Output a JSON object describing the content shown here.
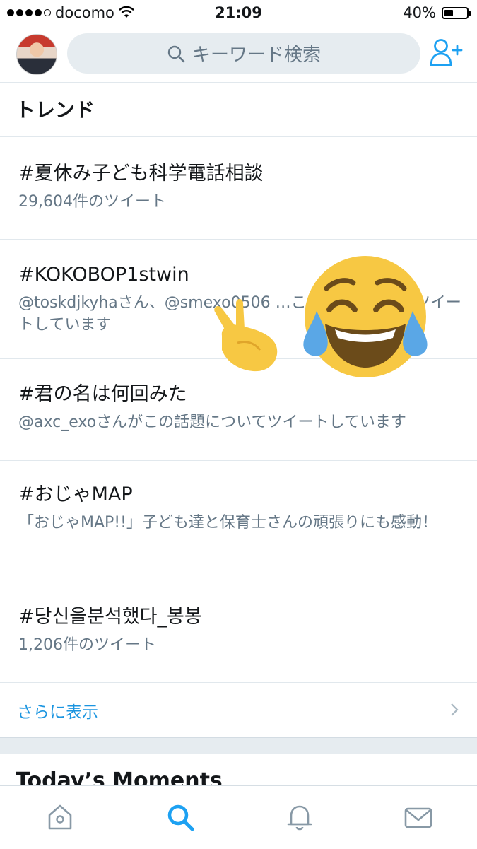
{
  "status_bar": {
    "carrier": "docomo",
    "time": "21:09",
    "battery": "40%",
    "battery_level": 0.4
  },
  "header": {
    "search_placeholder": "キーワード検索",
    "avatar": "profile-avatar",
    "add_user_icon": "add-user-icon"
  },
  "trends": {
    "title": "トレンド",
    "items": [
      {
        "name": "#夏休み子ども科学電話相談",
        "meta": "29,604件のツイート"
      },
      {
        "name": "#KOKOBOP1stwin",
        "meta": "@toskdjkyhaさん、@smexo0506 …この話題についてツイートしています"
      },
      {
        "name": "#君の名は何回みた",
        "meta": "@axc_exoさんがこの話題についてツイートしています"
      },
      {
        "name": "#おじゃMAP",
        "meta": "「おじゃMAP!!」子ども達と保育士さんの頑張りにも感動！"
      },
      {
        "name": "#당신을분석했다_봉봉",
        "meta": "1,206件のツイート"
      }
    ],
    "more_label": "さらに表示"
  },
  "moments": {
    "title": "Today’s Moments"
  },
  "tabbar": {
    "tabs": [
      "home-icon",
      "search-icon",
      "notifications-icon",
      "messages-icon"
    ],
    "active": "search-icon"
  },
  "colors": {
    "accent": "#1da1f2",
    "link": "#1b95e0",
    "secondary_text": "#657786",
    "divider": "#e1e8ed"
  }
}
